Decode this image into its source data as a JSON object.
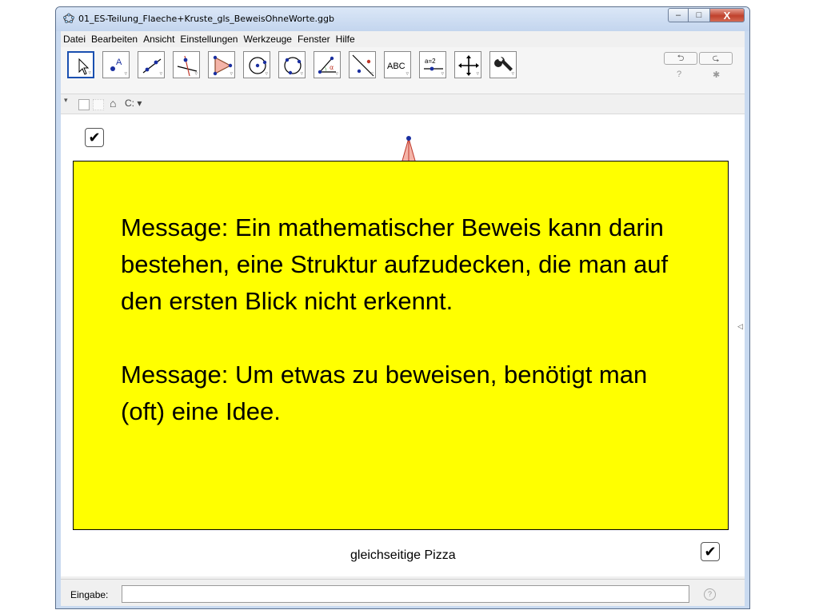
{
  "window": {
    "title": "01_ES-Teilung_Flaeche+Kruste_gls_BeweisOhneWorte.ggb",
    "minimize": "–",
    "maximize": "□",
    "close": "X"
  },
  "menu": [
    "Datei",
    "Bearbeiten",
    "Ansicht",
    "Einstellungen",
    "Werkzeuge",
    "Fenster",
    "Hilfe"
  ],
  "toolbar": {
    "tools": [
      {
        "icon": "move-arrow-icon"
      },
      {
        "icon": "point-icon",
        "label": "A"
      },
      {
        "icon": "line-icon"
      },
      {
        "icon": "perpendicular-line-icon"
      },
      {
        "icon": "polygon-icon"
      },
      {
        "icon": "circle-with-center-icon"
      },
      {
        "icon": "circle-through-points-icon"
      },
      {
        "icon": "angle-icon"
      },
      {
        "icon": "reflect-about-line-icon"
      },
      {
        "icon": "text-icon",
        "label": "ABC"
      },
      {
        "icon": "slider-icon",
        "label": "a=2"
      },
      {
        "icon": "move-graphics-view-icon"
      },
      {
        "icon": "tools-wrench-icon"
      }
    ],
    "undo": "⮌",
    "redo": "⮎",
    "help": "?",
    "settings": "✱"
  },
  "viewbar": {
    "triangle": "▾",
    "home": "⌂",
    "point_capture": "C: ▾"
  },
  "graphics": {
    "checkbox_top": "✔",
    "checkbox_bottom": "✔",
    "message_paragraph_1": "Message: Ein mathematischer Beweis kann darin bestehen, eine Struktur aufzudecken, die man auf den ersten Blick nicht erkennt.",
    "message_paragraph_2": "Message: Um etwas zu beweisen, benötigt man (oft) eine Idee.",
    "caption": "gleichseitige Pizza",
    "collapse_arrow": "◁"
  },
  "inputbar": {
    "label": "Eingabe:",
    "value": "",
    "help": "?"
  },
  "colors": {
    "message_background": "#ffff00",
    "point": "#1a2fa0",
    "triangle_stroke": "#c0392b",
    "triangle_fill": "#f4b4a8"
  }
}
